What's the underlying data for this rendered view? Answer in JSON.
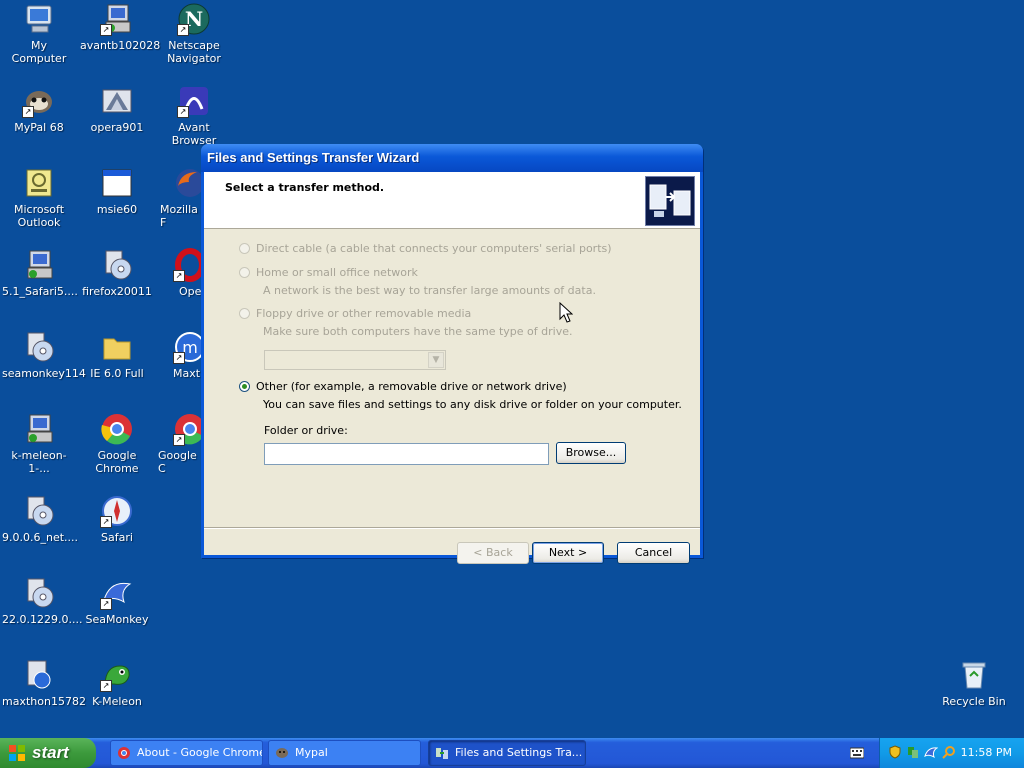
{
  "desktop": {
    "icons": [
      {
        "label": "My Computer",
        "icon": "my-computer-icon"
      },
      {
        "label": "avantb102028",
        "icon": "installer-icon"
      },
      {
        "label": "Netscape Navigator",
        "icon": "netscape-icon"
      },
      {
        "label": "MyPal 68",
        "icon": "mypal-icon"
      },
      {
        "label": "opera901",
        "icon": "opera-installer-icon"
      },
      {
        "label": "Avant Browser",
        "icon": "avant-browser-icon"
      },
      {
        "label": "Microsoft Outlook",
        "icon": "outlook-icon"
      },
      {
        "label": "msie60",
        "icon": "msie-window-icon"
      },
      {
        "label": "Mozilla F",
        "icon": "firefox-icon"
      },
      {
        "label": "5.1_Safari5....",
        "icon": "installer-icon"
      },
      {
        "label": "firefox20011",
        "icon": "installer-cd-icon"
      },
      {
        "label": "Ope",
        "icon": "opera-icon"
      },
      {
        "label": "seamonkey114",
        "icon": "installer-cd-icon"
      },
      {
        "label": "IE 6.0 Full",
        "icon": "folder-icon"
      },
      {
        "label": "Maxth",
        "icon": "maxthon-icon"
      },
      {
        "label": "k-meleon-1-...",
        "icon": "installer-icon"
      },
      {
        "label": "Google Chrome",
        "icon": "chrome-icon"
      },
      {
        "label": "Google C",
        "icon": "chrome-icon"
      },
      {
        "label": "9.0.0.6_net....",
        "icon": "installer-cd-icon"
      },
      {
        "label": "Safari",
        "icon": "safari-icon"
      },
      {
        "label": "22.0.1229.0....",
        "icon": "installer-cd-icon"
      },
      {
        "label": "SeaMonkey",
        "icon": "seamonkey-icon"
      },
      {
        "label": "maxthon15782",
        "icon": "installer-icon"
      },
      {
        "label": "K-Meleon",
        "icon": "k-meleon-icon"
      },
      {
        "label": "Recycle Bin",
        "icon": "recycle-bin-icon"
      }
    ]
  },
  "wizard": {
    "title": "Files and Settings Transfer Wizard",
    "header_title": "Select a transfer method.",
    "options": [
      {
        "label": "Direct cable (a cable that connects your computers' serial ports)",
        "description": "",
        "enabled": false,
        "selected": false
      },
      {
        "label": "Home or small office network",
        "description": "A network is the best way to transfer large amounts of data.",
        "enabled": false,
        "selected": false
      },
      {
        "label": "Floppy drive or other removable media",
        "description": "Make sure both computers have the same type of drive.",
        "enabled": false,
        "selected": false
      },
      {
        "label": "Other (for example, a removable drive or network drive)",
        "description": "You can save files and settings to any disk drive or folder on your computer.",
        "enabled": true,
        "selected": true
      }
    ],
    "drive_select_value": "",
    "folder_label": "Folder or drive:",
    "folder_value": "",
    "browse_label": "Browse...",
    "back_label": "< Back",
    "next_label": "Next >",
    "cancel_label": "Cancel"
  },
  "taskbar": {
    "start_label": "start",
    "tasks": [
      {
        "label": "About - Google Chrome",
        "icon": "chrome-icon",
        "active": false
      },
      {
        "label": "Mypal",
        "icon": "mypal-icon",
        "active": false
      },
      {
        "label": "Files and Settings Tra...",
        "icon": "transfer-wizard-icon",
        "active": true
      }
    ],
    "clock": "11:58 PM"
  },
  "colors": {
    "desktop": "#0a4e9c",
    "titlebar": "#0a58d8",
    "dialog_face": "#ece9d8",
    "taskbar": "#245edb",
    "start_button": "#3c9a3c",
    "tray": "#119be8"
  }
}
